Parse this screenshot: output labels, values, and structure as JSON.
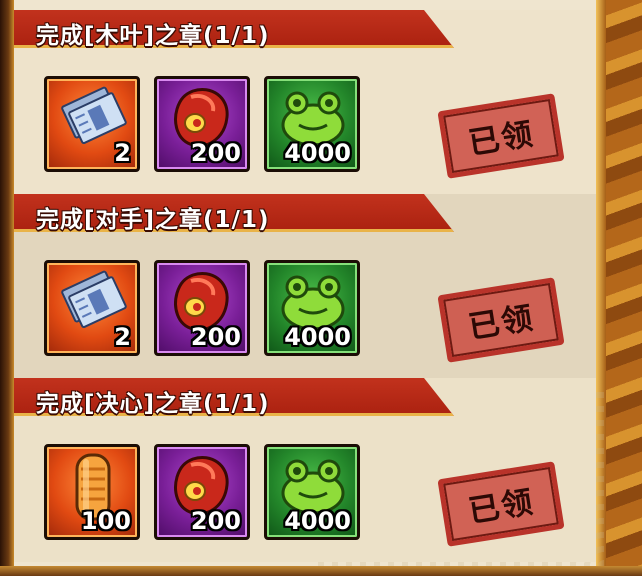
{
  "quests": [
    {
      "title": "完成[木叶]之章(1/1)",
      "status": "已领",
      "rewards": [
        {
          "icon": "blue-scroll-ticket-icon",
          "quantity": "2",
          "rarity": "orange"
        },
        {
          "icon": "red-meat-icon",
          "quantity": "200",
          "rarity": "purple"
        },
        {
          "icon": "green-frog-coin-purse-icon",
          "quantity": "4000",
          "rarity": "green"
        }
      ]
    },
    {
      "title": "完成[对手]之章(1/1)",
      "status": "已领",
      "rewards": [
        {
          "icon": "blue-scroll-ticket-icon",
          "quantity": "2",
          "rarity": "orange"
        },
        {
          "icon": "red-meat-icon",
          "quantity": "200",
          "rarity": "purple"
        },
        {
          "icon": "green-frog-coin-purse-icon",
          "quantity": "4000",
          "rarity": "green"
        }
      ]
    },
    {
      "title": "完成[决心]之章(1/1)",
      "status": "已领",
      "rewards": [
        {
          "icon": "orange-scroll-roll-icon",
          "quantity": "100",
          "rarity": "orange"
        },
        {
          "icon": "red-meat-icon",
          "quantity": "200",
          "rarity": "purple"
        },
        {
          "icon": "green-frog-coin-purse-icon",
          "quantity": "4000",
          "rarity": "green"
        }
      ]
    }
  ],
  "colors": {
    "banner": "#b5281a",
    "stamp": "#c9463c",
    "panel": "#efe5cf"
  }
}
